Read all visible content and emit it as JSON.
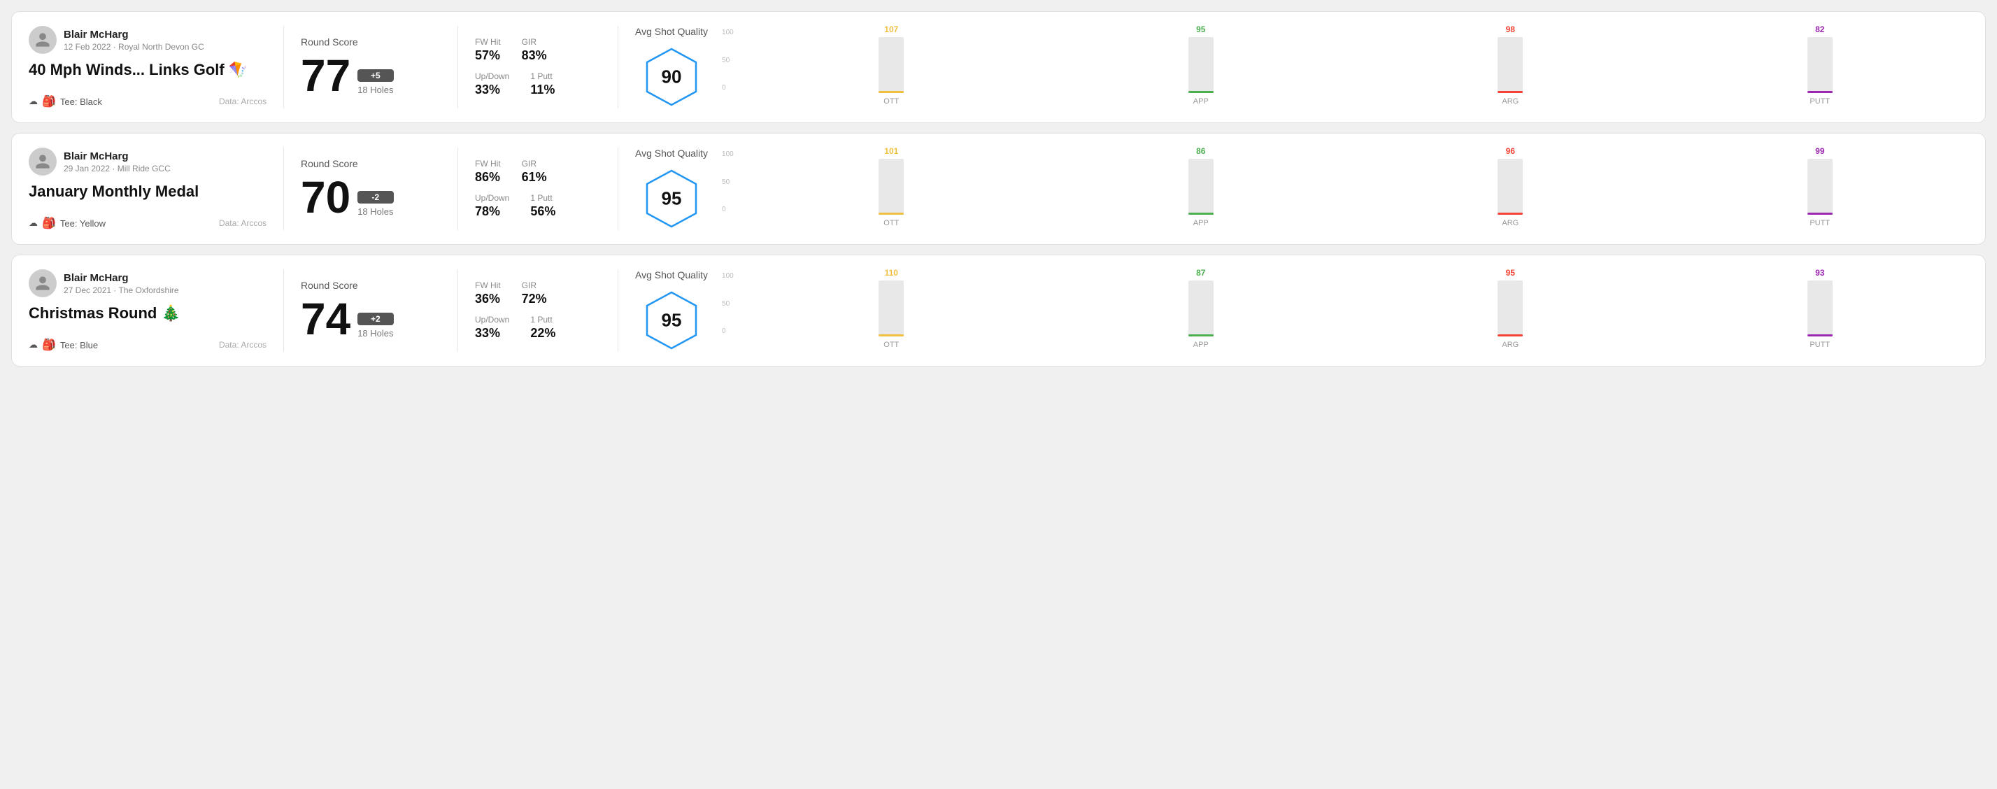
{
  "rounds": [
    {
      "id": "round-1",
      "user": {
        "name": "Blair McHarg",
        "date": "12 Feb 2022",
        "course": "Royal North Devon GC"
      },
      "title": "40 Mph Winds... Links Golf 🪁",
      "tee": "Black",
      "data_source": "Data: Arccos",
      "score": 77,
      "score_diff": "+5",
      "holes": "18 Holes",
      "fw_hit": "57%",
      "gir": "83%",
      "up_down": "33%",
      "one_putt": "11%",
      "avg_shot_quality": 90,
      "chart": {
        "ott": {
          "value": 107,
          "color": "#f0c040",
          "height_pct": 75
        },
        "app": {
          "value": 95,
          "color": "#4caf50",
          "height_pct": 62
        },
        "arg": {
          "value": 98,
          "color": "#f44336",
          "height_pct": 65
        },
        "putt": {
          "value": 82,
          "color": "#9c27b0",
          "height_pct": 52
        }
      }
    },
    {
      "id": "round-2",
      "user": {
        "name": "Blair McHarg",
        "date": "29 Jan 2022",
        "course": "Mill Ride GCC"
      },
      "title": "January Monthly Medal",
      "tee": "Yellow",
      "data_source": "Data: Arccos",
      "score": 70,
      "score_diff": "-2",
      "holes": "18 Holes",
      "fw_hit": "86%",
      "gir": "61%",
      "up_down": "78%",
      "one_putt": "56%",
      "avg_shot_quality": 95,
      "chart": {
        "ott": {
          "value": 101,
          "color": "#f0c040",
          "height_pct": 68
        },
        "app": {
          "value": 86,
          "color": "#4caf50",
          "height_pct": 55
        },
        "arg": {
          "value": 96,
          "color": "#f44336",
          "height_pct": 64
        },
        "putt": {
          "value": 99,
          "color": "#9c27b0",
          "height_pct": 67
        }
      }
    },
    {
      "id": "round-3",
      "user": {
        "name": "Blair McHarg",
        "date": "27 Dec 2021",
        "course": "The Oxfordshire"
      },
      "title": "Christmas Round 🎄",
      "tee": "Blue",
      "data_source": "Data: Arccos",
      "score": 74,
      "score_diff": "+2",
      "holes": "18 Holes",
      "fw_hit": "36%",
      "gir": "72%",
      "up_down": "33%",
      "one_putt": "22%",
      "avg_shot_quality": 95,
      "chart": {
        "ott": {
          "value": 110,
          "color": "#f0c040",
          "height_pct": 78
        },
        "app": {
          "value": 87,
          "color": "#4caf50",
          "height_pct": 56
        },
        "arg": {
          "value": 95,
          "color": "#f44336",
          "height_pct": 63
        },
        "putt": {
          "value": 93,
          "color": "#9c27b0",
          "height_pct": 61
        }
      }
    }
  ],
  "labels": {
    "round_score": "Round Score",
    "avg_shot_quality": "Avg Shot Quality",
    "fw_hit": "FW Hit",
    "gir": "GIR",
    "up_down": "Up/Down",
    "one_putt": "1 Putt",
    "data_arccos": "Data: Arccos",
    "tee_prefix": "Tee:",
    "chart_labels": [
      "OTT",
      "APP",
      "ARG",
      "PUTT"
    ],
    "chart_y": [
      "100",
      "50",
      "0"
    ]
  }
}
